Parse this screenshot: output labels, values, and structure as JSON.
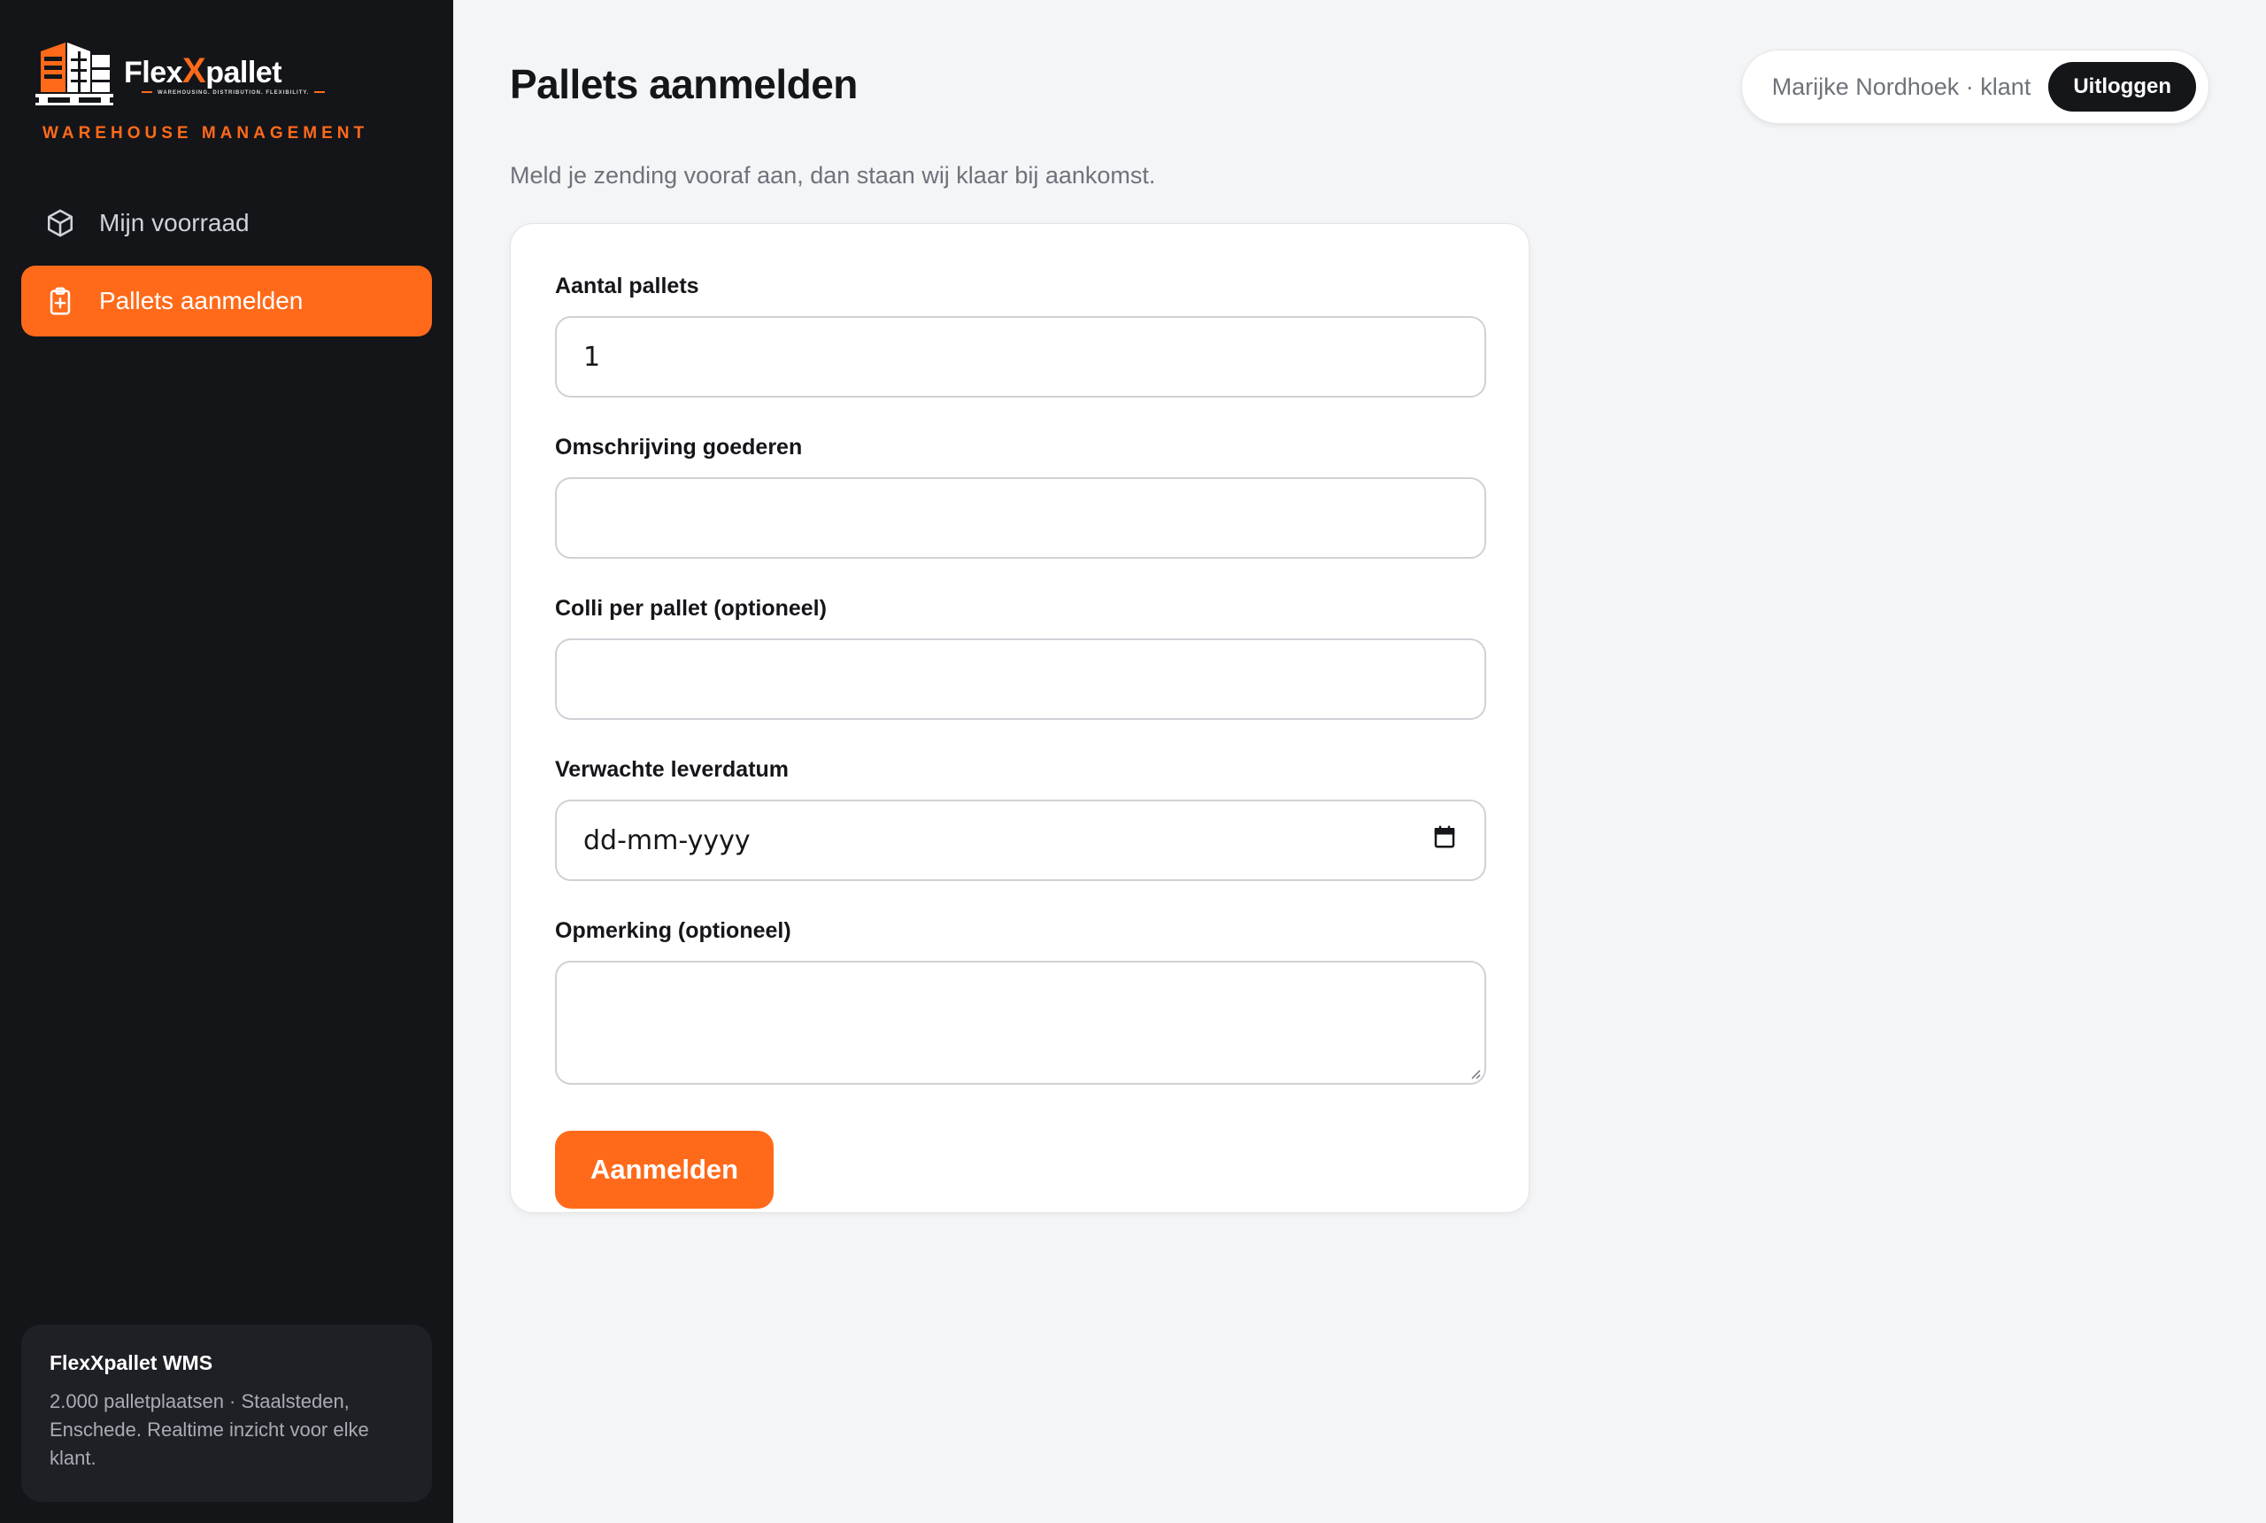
{
  "brand": {
    "name_part1": "Flex",
    "name_x": "X",
    "name_part2": "pallet",
    "tagline": "WAREHOUSING. DISTRIBUTION. FLEXIBILITY.",
    "subtitle": "WAREHOUSE MANAGEMENT",
    "accent_color": "#ff6a1a"
  },
  "sidebar": {
    "items": [
      {
        "label": "Mijn voorraad",
        "icon": "box-icon",
        "active": false
      },
      {
        "label": "Pallets aanmelden",
        "icon": "clipboard-plus-icon",
        "active": true
      }
    ],
    "info": {
      "title": "FlexXpallet WMS",
      "text": "2.000 palletplaatsen · Staalsteden, Enschede. Realtime inzicht voor elke klant."
    }
  },
  "header": {
    "title": "Pallets aanmelden",
    "subtitle": "Meld je zending vooraf aan, dan staan wij klaar bij aankomst.",
    "user": "Marijke Nordhoek · klant",
    "logout_label": "Uitloggen"
  },
  "form": {
    "fields": [
      {
        "label": "Aantal pallets",
        "value": "1"
      },
      {
        "label": "Omschrijving goederen",
        "value": ""
      },
      {
        "label": "Colli per pallet (optioneel)",
        "value": ""
      },
      {
        "label": "Verwachte leverdatum",
        "value": "dd-mm-yyyy"
      },
      {
        "label": "Opmerking (optioneel)",
        "value": ""
      }
    ],
    "submit_label": "Aanmelden"
  }
}
